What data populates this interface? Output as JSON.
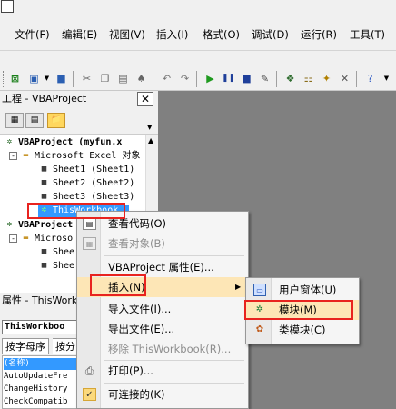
{
  "menubar": {
    "items": [
      "文件(F)",
      "编辑(E)",
      "视图(V)",
      "插入(I)",
      "格式(O)",
      "调试(D)",
      "运行(R)",
      "工具(T)"
    ]
  },
  "project_panel": {
    "title": "工程 - VBAProject",
    "close": "✕",
    "tree": [
      "VBAProject (myfun.x",
      "Microsoft Excel 对象",
      "Sheet1 (Sheet1)",
      "Sheet2 (Sheet2)",
      "Sheet3 (Sheet3)",
      "ThisWorkbook",
      "VBAProject",
      "Microso",
      "Shee",
      "Shee"
    ]
  },
  "properties_panel": {
    "title": "属性 - ThisWorkb",
    "object": "ThisWorkboo",
    "tabs": [
      "按字母序",
      "按分"
    ],
    "rows": [
      "(名称)",
      "AutoUpdateFre",
      "ChangeHistory",
      "CheckCompatib"
    ]
  },
  "context_menu": {
    "items": [
      {
        "label": "查看代码(O)",
        "icon": "code-icon",
        "disabled": false
      },
      {
        "label": "查看对象(B)",
        "icon": "object-icon",
        "disabled": true
      },
      {
        "label": "VBAProject 属性(E)...",
        "icon": "",
        "disabled": false
      },
      {
        "label": "插入(N)",
        "icon": "",
        "disabled": false,
        "submenu": true
      },
      {
        "label": "导入文件(I)...",
        "icon": "",
        "disabled": false
      },
      {
        "label": "导出文件(E)...",
        "icon": "",
        "disabled": false
      },
      {
        "label": "移除 ThisWorkbook(R)...",
        "icon": "",
        "disabled": true
      },
      {
        "label": "打印(P)...",
        "icon": "print-icon",
        "disabled": false
      },
      {
        "label": "可连接的(K)",
        "icon": "check-icon",
        "disabled": false
      }
    ]
  },
  "submenu": {
    "items": [
      {
        "label": "用户窗体(U)",
        "icon": "userform-icon"
      },
      {
        "label": "模块(M)",
        "icon": "module-icon"
      },
      {
        "label": "类模块(C)",
        "icon": "class-module-icon"
      }
    ]
  },
  "colors": {
    "highlight": "#fde6b6",
    "annotation": "#e8231f",
    "workspace": "#808080"
  }
}
